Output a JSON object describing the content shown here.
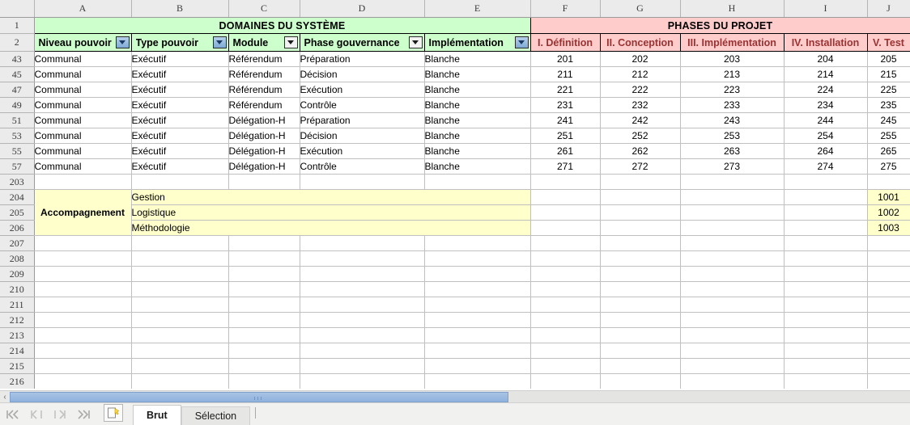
{
  "app": {
    "type": "spreadsheet"
  },
  "columns": {
    "row_header": "",
    "letters": [
      "A",
      "B",
      "C",
      "D",
      "E",
      "F",
      "G",
      "H",
      "I",
      "J"
    ]
  },
  "banners": {
    "left": "DOMAINES DU SYSTÈME",
    "right": "PHASES DU PROJET",
    "left_color": "#ccffcc",
    "right_color": "#ffcccc"
  },
  "headers": {
    "green": [
      {
        "label": "Niveau pouvoir",
        "filter": "active"
      },
      {
        "label": "Type pouvoir",
        "filter": "active"
      },
      {
        "label": "Module",
        "filter": "plain"
      },
      {
        "label": "Phase gouvernance",
        "filter": "plain"
      },
      {
        "label": "Implémentation",
        "filter": "active"
      }
    ],
    "pink": [
      {
        "label": "I. Définition"
      },
      {
        "label": "II. Conception"
      },
      {
        "label": "III. Implémentation"
      },
      {
        "label": "IV. Installation"
      },
      {
        "label": "V. Test"
      }
    ]
  },
  "rows": [
    {
      "n": "43",
      "a": "Communal",
      "b": "Exécutif",
      "c": "Référendum",
      "d": "Préparation",
      "e": "Blanche",
      "f": "201",
      "g": "202",
      "h": "203",
      "i": "204",
      "j": "205"
    },
    {
      "n": "45",
      "a": "Communal",
      "b": "Exécutif",
      "c": "Référendum",
      "d": "Décision",
      "e": "Blanche",
      "f": "211",
      "g": "212",
      "h": "213",
      "i": "214",
      "j": "215"
    },
    {
      "n": "47",
      "a": "Communal",
      "b": "Exécutif",
      "c": "Référendum",
      "d": "Exécution",
      "e": "Blanche",
      "f": "221",
      "g": "222",
      "h": "223",
      "i": "224",
      "j": "225"
    },
    {
      "n": "49",
      "a": "Communal",
      "b": "Exécutif",
      "c": "Référendum",
      "d": "Contrôle",
      "e": "Blanche",
      "f": "231",
      "g": "232",
      "h": "233",
      "i": "234",
      "j": "235"
    },
    {
      "n": "51",
      "a": "Communal",
      "b": "Exécutif",
      "c": "Délégation-H",
      "d": "Préparation",
      "e": "Blanche",
      "f": "241",
      "g": "242",
      "h": "243",
      "i": "244",
      "j": "245"
    },
    {
      "n": "53",
      "a": "Communal",
      "b": "Exécutif",
      "c": "Délégation-H",
      "d": "Décision",
      "e": "Blanche",
      "f": "251",
      "g": "252",
      "h": "253",
      "i": "254",
      "j": "255"
    },
    {
      "n": "55",
      "a": "Communal",
      "b": "Exécutif",
      "c": "Délégation-H",
      "d": "Exécution",
      "e": "Blanche",
      "f": "261",
      "g": "262",
      "h": "263",
      "i": "264",
      "j": "265"
    },
    {
      "n": "57",
      "a": "Communal",
      "b": "Exécutif",
      "c": "Délégation-H",
      "d": "Contrôle",
      "e": "Blanche",
      "f": "271",
      "g": "272",
      "h": "273",
      "i": "274",
      "j": "275"
    }
  ],
  "gap_row": {
    "n": "203"
  },
  "accompagnement": {
    "label": "Accompagnement",
    "row_numbers": [
      "204",
      "205",
      "206"
    ],
    "items": [
      {
        "n": "204",
        "name": "Gestion",
        "j": "1001"
      },
      {
        "n": "205",
        "name": "Logistique",
        "j": "1002"
      },
      {
        "n": "206",
        "name": "Méthodologie",
        "j": "1003"
      }
    ],
    "fill_color": "#ffffcc"
  },
  "empty_rows": [
    "207",
    "208",
    "209",
    "210",
    "211",
    "212",
    "213",
    "214",
    "215",
    "216"
  ],
  "scrollbar": {
    "left_arrow": "‹"
  },
  "tabbar": {
    "nav": [
      {
        "icon": "first-sheet-icon",
        "glyph": "|⟨⟨"
      },
      {
        "icon": "previous-sheet-icon",
        "glyph": "⟨⟨|"
      },
      {
        "icon": "next-sheet-icon",
        "glyph": "|⟩⟩"
      },
      {
        "icon": "last-sheet-icon",
        "glyph": "⟩⟩|"
      }
    ],
    "add_sheet": "add-sheet-icon",
    "tabs": [
      {
        "label": "Brut",
        "active": true
      },
      {
        "label": "Sélection",
        "active": false
      }
    ]
  }
}
